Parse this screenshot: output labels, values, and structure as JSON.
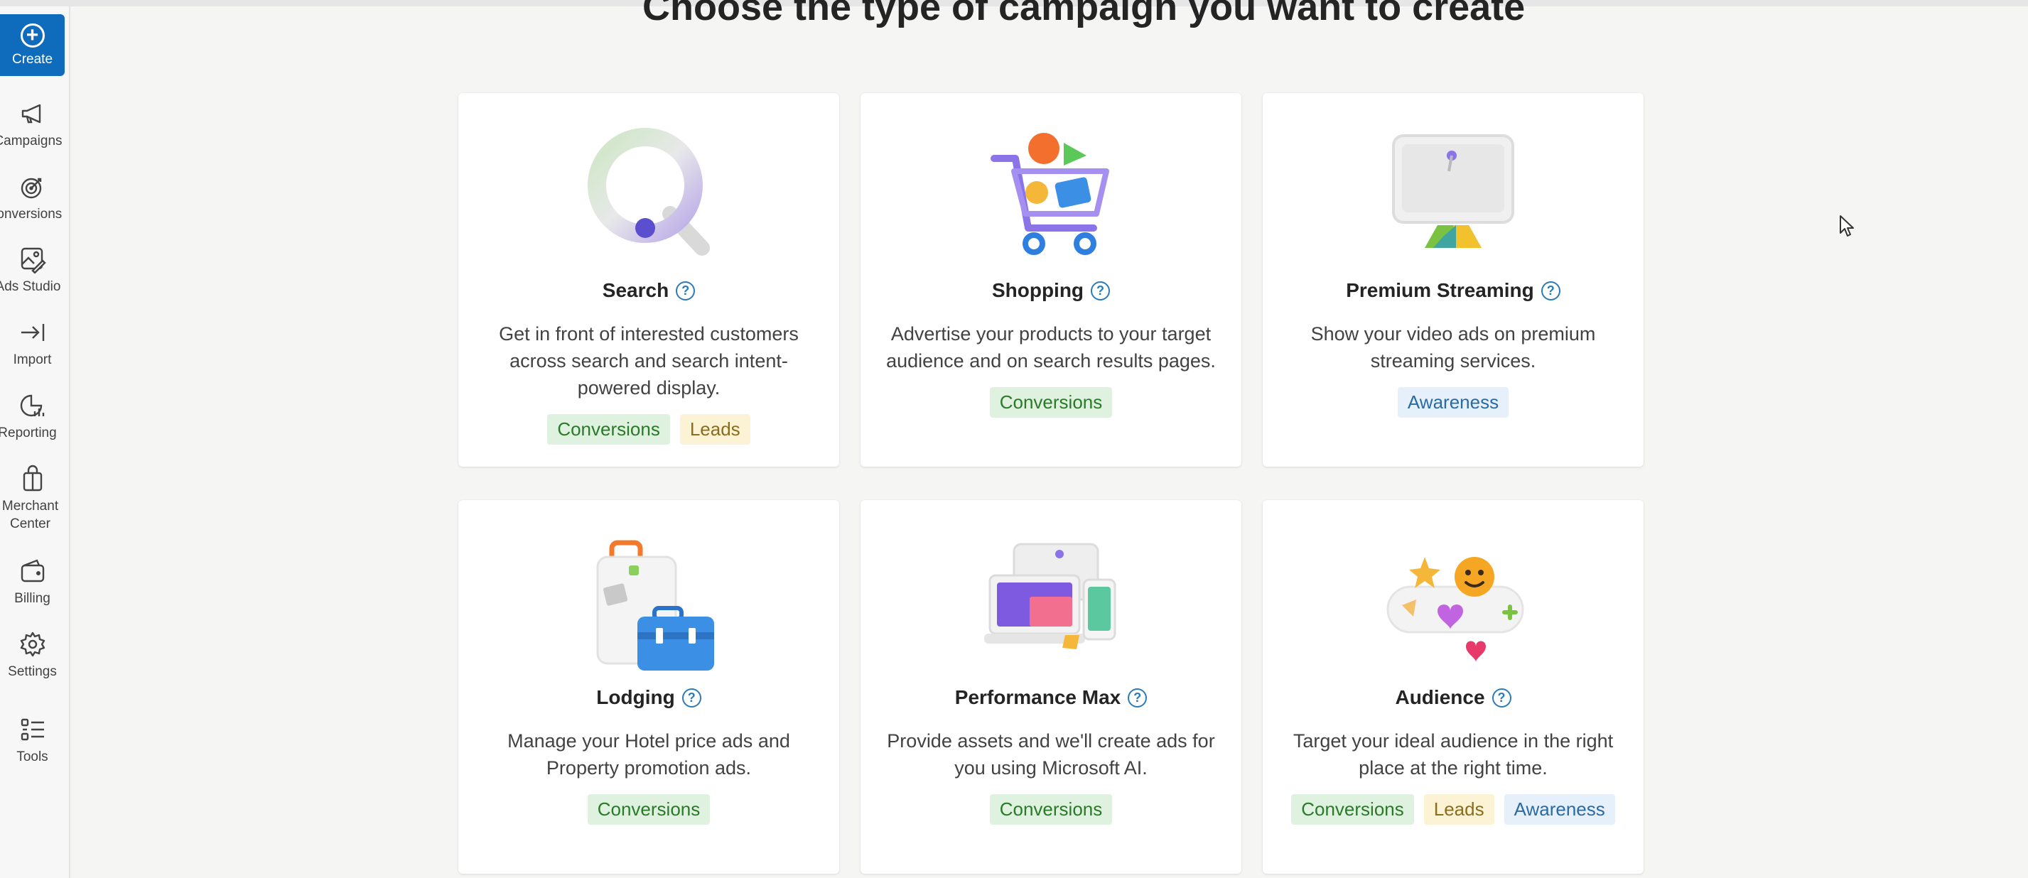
{
  "page": {
    "heading": "Choose the type of campaign you want to create"
  },
  "sidebar": {
    "create": {
      "label": "Create",
      "icon": "plus-circle-icon"
    },
    "items": [
      {
        "label": "Campaigns",
        "icon": "megaphone-icon"
      },
      {
        "label": "Conversions",
        "icon": "target-icon"
      },
      {
        "label": "Ads Studio",
        "icon": "image-edit-icon"
      },
      {
        "label": "Import",
        "icon": "import-arrow-icon"
      },
      {
        "label": "Reporting",
        "icon": "report-chart-icon"
      },
      {
        "label": "Merchant Center",
        "icon": "shopping-bag-icon"
      },
      {
        "label": "Billing",
        "icon": "wallet-icon"
      },
      {
        "label": "Settings",
        "icon": "gear-icon"
      },
      {
        "label": "Tools",
        "icon": "list-icon"
      }
    ]
  },
  "cards": [
    {
      "title": "Search",
      "description": "Get in front of interested customers across search and search intent-powered display.",
      "tags": [
        "Conversions",
        "Leads"
      ]
    },
    {
      "title": "Shopping",
      "description": "Advertise your products to your target audience and on search results pages.",
      "tags": [
        "Conversions"
      ]
    },
    {
      "title": "Premium Streaming",
      "description": "Show your video ads on premium streaming services.",
      "tags": [
        "Awareness"
      ]
    },
    {
      "title": "Lodging",
      "description": "Manage your Hotel price ads and Property promotion ads.",
      "tags": [
        "Conversions"
      ]
    },
    {
      "title": "Performance Max",
      "description": "Provide assets and we'll create ads for you using Microsoft AI.",
      "tags": [
        "Conversions"
      ]
    },
    {
      "title": "Audience",
      "description": "Target your ideal audience in the right place at the right time.",
      "tags": [
        "Conversions",
        "Leads",
        "Awareness"
      ]
    }
  ],
  "colors": {
    "accent": "#0f6cbd",
    "conversions_tag_bg": "#dff2df",
    "leads_tag_bg": "#fcf3d4",
    "awareness_tag_bg": "#e6f0fa"
  }
}
